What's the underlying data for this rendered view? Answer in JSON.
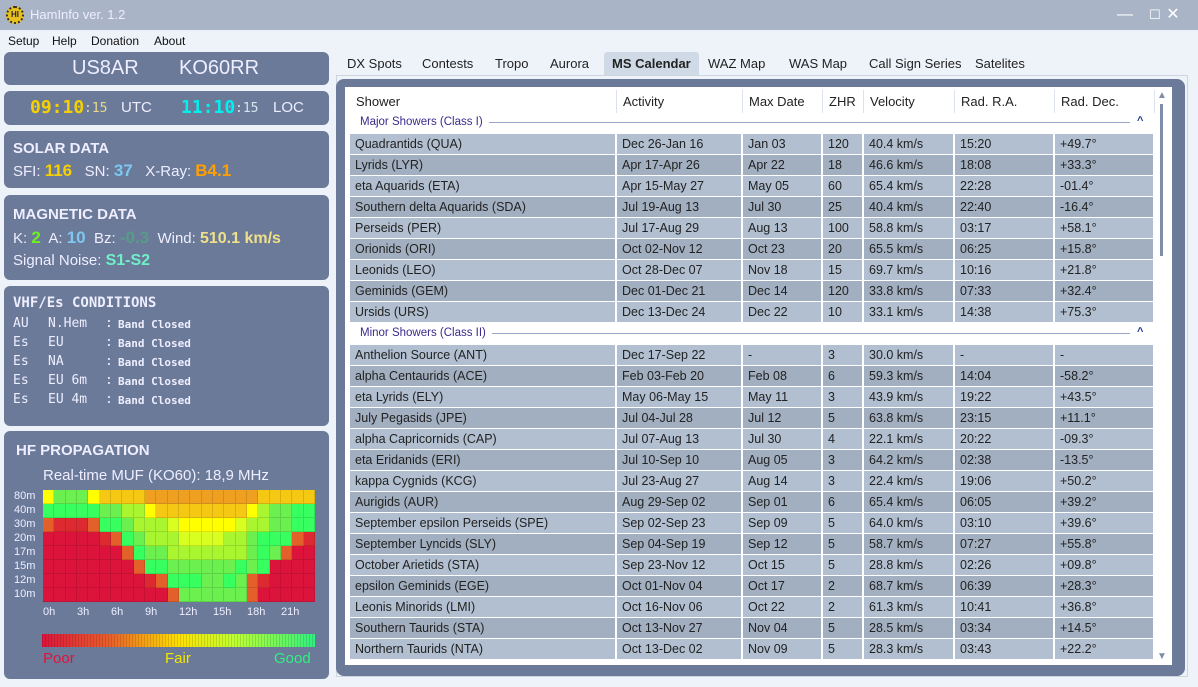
{
  "window": {
    "title": "HamInfo ver. 1.2",
    "icon": "haminfo-logo-icon",
    "minimize": "—",
    "maximize": "☐",
    "close": "✕"
  },
  "menu": [
    "Setup",
    "Help",
    "Donation",
    "About"
  ],
  "station": {
    "callsign": "US8AR",
    "locator": "KO60RR"
  },
  "clock": {
    "utc_hm": "09:10",
    "utc_s": ":15",
    "utc_label": "UTC",
    "loc_hm": "11:10",
    "loc_s": ":15",
    "loc_label": "LOC"
  },
  "solar": {
    "title": "SOLAR DATA",
    "sfi_label": "SFI:",
    "sfi": "116",
    "sn_label": "SN:",
    "sn": "37",
    "xray_label": "X-Ray:",
    "xray": "B4.1"
  },
  "magnetic": {
    "title": "MAGNETIC DATA",
    "k_label": "K:",
    "k": "2",
    "a_label": "A:",
    "a": "10",
    "bz_label": "Bz:",
    "bz": "-0.3",
    "wind_label": "Wind:",
    "wind": "510.1 km/s",
    "noise_label": "Signal Noise:",
    "noise": "S1-S2"
  },
  "vhf": {
    "title": "VHF/Es CONDITIONS",
    "rows": [
      {
        "type": "AU",
        "region": "N.Hem",
        "sep": ":",
        "status": "Band Closed"
      },
      {
        "type": "Es",
        "region": "EU",
        "sep": ":",
        "status": "Band Closed"
      },
      {
        "type": "Es",
        "region": "NA",
        "sep": ":",
        "status": "Band Closed"
      },
      {
        "type": "Es",
        "region": "EU 6m",
        "sep": ":",
        "status": "Band Closed"
      },
      {
        "type": "Es",
        "region": "EU 4m",
        "sep": ":",
        "status": "Band Closed"
      }
    ]
  },
  "hf": {
    "title": "HF PROPAGATION",
    "muf": "Real-time MUF (KO60): 18,9 MHz",
    "bands": [
      "80m",
      "40m",
      "30m",
      "20m",
      "17m",
      "15m",
      "12m",
      "10m"
    ],
    "hours": [
      "0h",
      "3h",
      "6h",
      "9h",
      "12h",
      "15h",
      "18h",
      "21h"
    ],
    "legend": {
      "poor": "Poor",
      "fair": "Fair",
      "good": "Good"
    },
    "colors": {
      "R": "#dc143c",
      "r": "#dc2a30",
      "O": "#e4602a",
      "a": "#f0a020",
      "y": "#f5c814",
      "Y": "#ffff00",
      "L": "#d8ff20",
      "l": "#a8f530",
      "g": "#6cf050",
      "G": "#38ff60"
    },
    "grid": [
      "YgggYyyyyaaaaaaaaaayyyyy",
      "GGGGGggllYyyyyyyyyYlggGG",
      "OrrrOGGglllLYYYYYLllggGG",
      "RRRRRrOGglllLLLLllgGGGOr",
      "RRRRRRROGgglllllllgGgORR",
      "RRRRRRRROGGggggggGgGRRRR",
      "RRRRRRRRRrOGGGggGgOrRRRR",
      "RRRRRRRRRRROggggggORRRRR"
    ]
  },
  "tabs": [
    "DX Spots",
    "Contests",
    "Tropo",
    "Aurora",
    "MS Calendar",
    "WAZ Map",
    "WAS Map",
    "Call Sign Series",
    "Satelites"
  ],
  "active_tab": "MS Calendar",
  "table": {
    "columns": [
      "Shower",
      "Activity",
      "Max Date",
      "ZHR",
      "Velocity",
      "Rad. R.A.",
      "Rad. Dec."
    ],
    "groups": [
      {
        "label": "Major Showers (Class I)",
        "rows": [
          [
            "Quadrantids (QUA)",
            "Dec 26-Jan 16",
            "Jan 03",
            "120",
            "40.4 km/s",
            "15:20",
            "+49.7°"
          ],
          [
            "Lyrids (LYR)",
            "Apr 17-Apr 26",
            "Apr 22",
            "18",
            "46.6 km/s",
            "18:08",
            "+33.3°"
          ],
          [
            "eta Aquarids (ETA)",
            "Apr 15-May 27",
            "May 05",
            "60",
            "65.4 km/s",
            "22:28",
            "-01.4°"
          ],
          [
            "Southern delta Aquarids (SDA)",
            "Jul 19-Aug 13",
            "Jul 30",
            "25",
            "40.4 km/s",
            "22:40",
            "-16.4°"
          ],
          [
            "Perseids (PER)",
            "Jul 17-Aug 29",
            "Aug 13",
            "100",
            "58.8 km/s",
            "03:17",
            "+58.1°"
          ],
          [
            "Orionids (ORI)",
            "Oct 02-Nov 12",
            "Oct 23",
            "20",
            "65.5 km/s",
            "06:25",
            "+15.8°"
          ],
          [
            "Leonids (LEO)",
            "Oct 28-Dec 07",
            "Nov 18",
            "15",
            "69.7 km/s",
            "10:16",
            "+21.8°"
          ],
          [
            "Geminids (GEM)",
            "Dec 01-Dec 21",
            "Dec 14",
            "120",
            "33.8 km/s",
            "07:33",
            "+32.4°"
          ],
          [
            "Ursids (URS)",
            "Dec 13-Dec 24",
            "Dec 22",
            "10",
            "33.1 km/s",
            "14:38",
            "+75.3°"
          ]
        ]
      },
      {
        "label": "Minor Showers (Class II)",
        "rows": [
          [
            "Anthelion Source (ANT)",
            "Dec 17-Sep 22",
            "-",
            "3",
            "30.0 km/s",
            "-",
            "-"
          ],
          [
            "alpha Centaurids (ACE)",
            "Feb 03-Feb 20",
            "Feb 08",
            "6",
            "59.3 km/s",
            "14:04",
            "-58.2°"
          ],
          [
            "eta Lyrids (ELY)",
            "May 06-May 15",
            "May 11",
            "3",
            "43.9 km/s",
            "19:22",
            "+43.5°"
          ],
          [
            "July Pegasids (JPE)",
            "Jul 04-Jul 28",
            "Jul 12",
            "5",
            "63.8 km/s",
            "23:15",
            "+11.1°"
          ],
          [
            "alpha Capricornids (CAP)",
            "Jul 07-Aug 13",
            "Jul 30",
            "4",
            "22.1 km/s",
            "20:22",
            "-09.3°"
          ],
          [
            "eta Eridanids (ERI)",
            "Jul 10-Sep 10",
            "Aug 05",
            "3",
            "64.2 km/s",
            "02:38",
            "-13.5°"
          ],
          [
            "kappa Cygnids (KCG)",
            "Jul 23-Aug 27",
            "Aug 14",
            "3",
            "22.4 km/s",
            "19:06",
            "+50.2°"
          ],
          [
            "Aurigids (AUR)",
            "Aug 29-Sep 02",
            "Sep 01",
            "6",
            "65.4 km/s",
            "06:05",
            "+39.2°"
          ],
          [
            "September epsilon Perseids (SPE)",
            "Sep 02-Sep 23",
            "Sep 09",
            "5",
            "64.0 km/s",
            "03:10",
            "+39.6°"
          ],
          [
            "September Lyncids (SLY)",
            "Sep 04-Sep 19",
            "Sep 12",
            "5",
            "58.7 km/s",
            "07:27",
            "+55.8°"
          ],
          [
            "October Arietids (STA)",
            "Sep 23-Nov 12",
            "Oct 15",
            "5",
            "28.8 km/s",
            "02:26",
            "+09.8°"
          ],
          [
            "epsilon Geminids (EGE)",
            "Oct 01-Nov 04",
            "Oct 17",
            "2",
            "68.7 km/s",
            "06:39",
            "+28.3°"
          ],
          [
            "Leonis Minorids (LMI)",
            "Oct 16-Nov 06",
            "Oct 22",
            "2",
            "61.3 km/s",
            "10:41",
            "+36.8°"
          ],
          [
            "Southern Taurids (STA)",
            "Oct 13-Nov 27",
            "Nov 04",
            "5",
            "28.5 km/s",
            "03:34",
            "+14.5°"
          ],
          [
            "Northern Taurids (NTA)",
            "Oct 13-Dec 02",
            "Nov 09",
            "5",
            "28.3 km/s",
            "03:43",
            "+22.2°"
          ]
        ]
      }
    ]
  },
  "scroll": {
    "up": "▲",
    "down": "▼",
    "collapse": "^"
  }
}
